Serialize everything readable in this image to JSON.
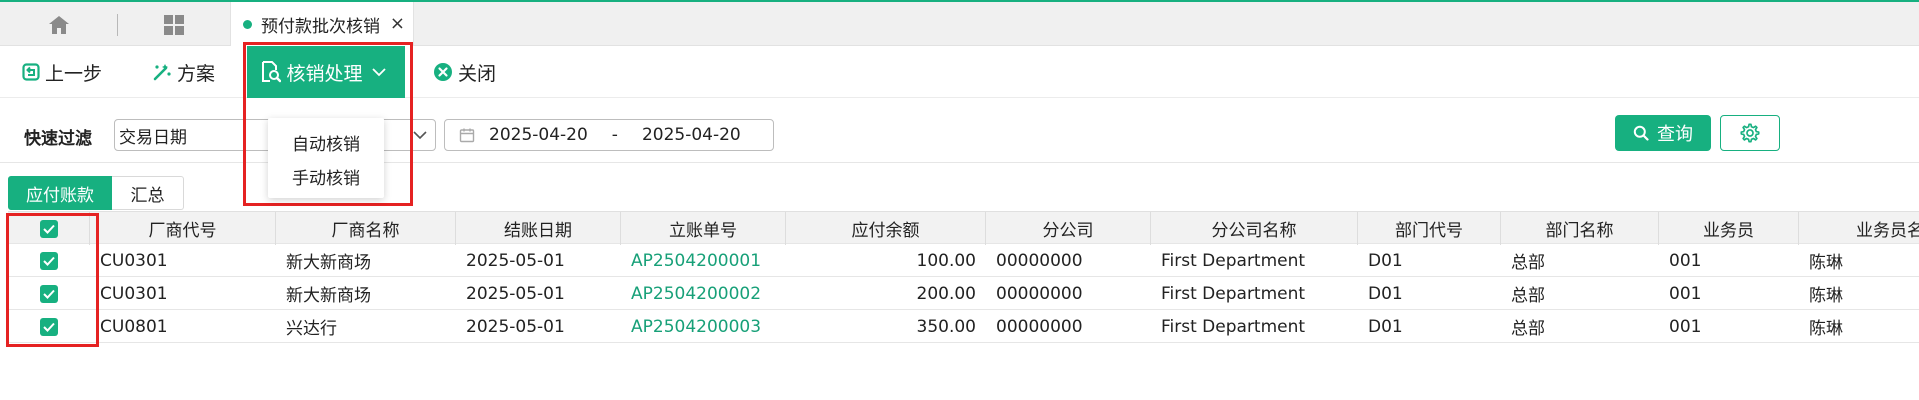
{
  "tabs": {
    "active_label": "预付款批次核销",
    "close_glyph": "×"
  },
  "toolbar": {
    "prev_label": "上一步",
    "plan_label": "方案",
    "process_label": "核销处理",
    "close_label": "关闭"
  },
  "dropdown": {
    "items": [
      "自动核销",
      "手动核销"
    ]
  },
  "filter": {
    "label": "快速过滤",
    "field_value": "交易日期",
    "date_start": "2025-04-20",
    "date_sep": "-",
    "date_end": "2025-04-20",
    "query_label": "查询"
  },
  "view_tabs": [
    "应付账款",
    "汇总"
  ],
  "table": {
    "columns": [
      "厂商代号",
      "厂商名称",
      "结账日期",
      "立账单号",
      "应付余额",
      "分公司",
      "分公司名称",
      "部门代号",
      "部门名称",
      "业务员",
      "业务员名称"
    ],
    "rows": [
      [
        "CU0301",
        "新大新商场",
        "2025-05-01",
        "AP2504200001",
        "100.00",
        "00000000",
        "First Department",
        "D01",
        "总部",
        "001",
        "陈琳"
      ],
      [
        "CU0301",
        "新大新商场",
        "2025-05-01",
        "AP2504200002",
        "200.00",
        "00000000",
        "First Department",
        "D01",
        "总部",
        "001",
        "陈琳"
      ],
      [
        "CU0801",
        "兴达行",
        "2025-05-01",
        "AP2504200003",
        "350.00",
        "00000000",
        "First Department",
        "D01",
        "总部",
        "001",
        "陈琳"
      ]
    ]
  },
  "colors": {
    "accent": "#17b080",
    "link": "#17a078",
    "highlight": "#e52222"
  },
  "icons": [
    "home-icon",
    "grid-icon",
    "back-icon",
    "wand-icon",
    "doc-search-icon",
    "chevron-down-icon",
    "close-circle-icon",
    "calendar-icon",
    "search-icon",
    "gear-icon",
    "check-icon"
  ]
}
